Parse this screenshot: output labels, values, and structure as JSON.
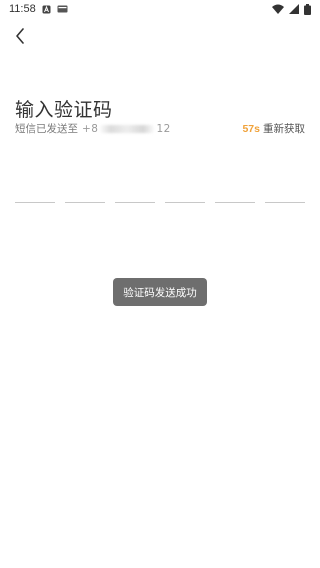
{
  "status_bar": {
    "time": "11:58",
    "left_icons": [
      "notification-a-icon",
      "card-icon"
    ],
    "right_icons": [
      "wifi-icon",
      "signal-icon",
      "battery-icon"
    ]
  },
  "nav": {
    "back_icon": "chevron-left-icon"
  },
  "page": {
    "title": "输入验证码",
    "sent_prefix": "短信已发送至",
    "phone_start": "+8",
    "phone_end": "12",
    "countdown": "57s",
    "resend_label": "重新获取",
    "countdown_color": "#f0a23a"
  },
  "code_inputs": [
    "",
    "",
    "",
    "",
    "",
    ""
  ],
  "toast": {
    "message": "验证码发送成功"
  }
}
